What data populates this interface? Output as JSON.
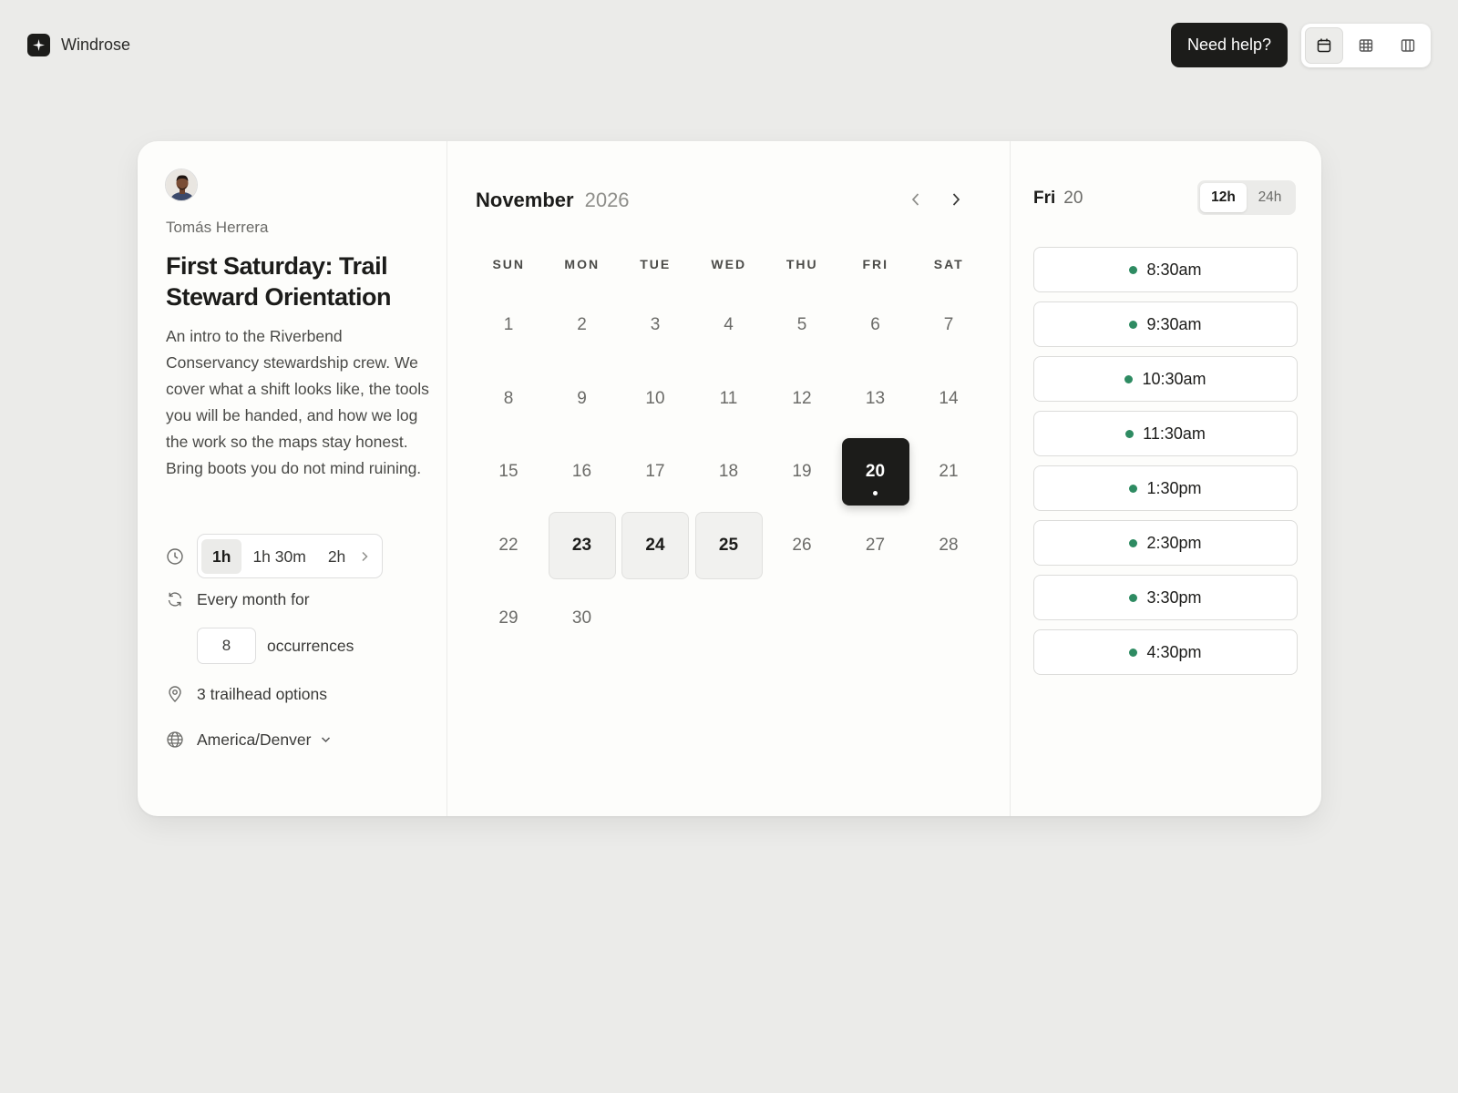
{
  "brand": {
    "name": "Windrose"
  },
  "header": {
    "help_label": "Need help?",
    "views": [
      {
        "name": "month-view",
        "icon": "calendar-icon",
        "active": true
      },
      {
        "name": "week-view",
        "icon": "grid-icon",
        "active": false
      },
      {
        "name": "column-view",
        "icon": "columns-icon",
        "active": false
      }
    ]
  },
  "event": {
    "host": "Tomás Herrera",
    "title": "First Saturday: Trail Steward Orientation",
    "description": "An intro to the Riverbend Conservancy stewardship crew. We cover what a shift looks like, the tools you will be handed, and how we log the work so the maps stay honest. Bring boots you do not mind ruining.",
    "durations": [
      "1h",
      "1h 30m",
      "2h"
    ],
    "selected_duration": "1h",
    "recurrence_label": "Every month for",
    "occurrences_value": "8",
    "occurrences_label": "occurrences",
    "location": "3 trailhead options",
    "timezone": "America/Denver"
  },
  "calendar": {
    "month": "November",
    "year": "2026",
    "weekdays": [
      "SUN",
      "MON",
      "TUE",
      "WED",
      "THU",
      "FRI",
      "SAT"
    ],
    "first_weekday_index": 0,
    "days_in_month": 30,
    "available_days": [
      23,
      24,
      25
    ],
    "selected_day": 20
  },
  "slots": {
    "day_label": "Fri",
    "date_label": "20",
    "format_options": [
      "12h",
      "24h"
    ],
    "active_format": "12h",
    "times": [
      "8:30am",
      "9:30am",
      "10:30am",
      "11:30am",
      "1:30pm",
      "2:30pm",
      "3:30pm",
      "4:30pm"
    ],
    "accent_color": "#2e8b62"
  }
}
